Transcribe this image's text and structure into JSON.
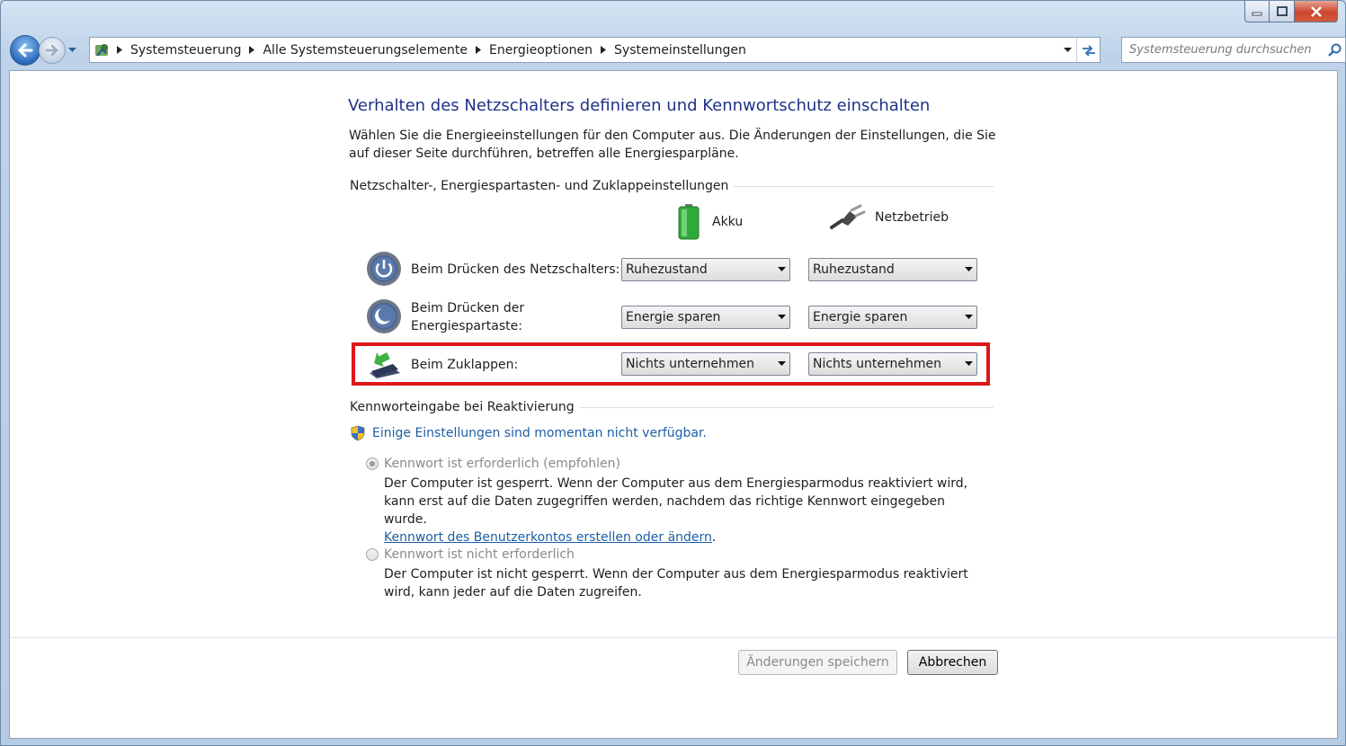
{
  "toolbar": {
    "breadcrumbs": [
      "Systemsteuerung",
      "Alle Systemsteuerungselemente",
      "Energieoptionen",
      "Systemeinstellungen"
    ],
    "search_placeholder": "Systemsteuerung durchsuchen"
  },
  "page": {
    "title": "Verhalten des Netzschalters definieren und Kennwortschutz einschalten",
    "intro": "Wählen Sie die Energieeinstellungen für den Computer aus. Die Änderungen der Einstellungen, die Sie auf dieser Seite durchführen, betreffen alle Energiesparpläne."
  },
  "buttons_section": {
    "heading": "Netzschalter-, Energiespartasten- und Zuklappeinstellungen",
    "col_battery": "Akku",
    "col_ac": "Netzbetrieb",
    "rows": [
      {
        "label": "Beim Drücken des Netzschalters:",
        "battery": "Ruhezustand",
        "ac": "Ruhezustand",
        "icon": "power-button-icon"
      },
      {
        "label_line1": "Beim Drücken der",
        "label_line2": "Energiespartaste:",
        "battery": "Energie sparen",
        "ac": "Energie sparen",
        "icon": "sleep-button-icon"
      },
      {
        "label": "Beim Zuklappen:",
        "battery": "Nichts unternehmen",
        "ac": "Nichts unternehmen",
        "icon": "lid-close-icon"
      }
    ]
  },
  "password_section": {
    "heading": "Kennworteingabe bei Reaktivierung",
    "uac_link": "Einige Einstellungen sind momentan nicht verfügbar.",
    "option_required": {
      "label": "Kennwort ist erforderlich (empfohlen)",
      "desc": "Der Computer ist gesperrt. Wenn der Computer aus dem Energiesparmodus reaktiviert wird, kann erst auf die Daten zugegriffen werden, nachdem das richtige Kennwort eingegeben wurde.",
      "link": "Kennwort des Benutzerkontos erstellen oder ändern",
      "selected": true
    },
    "option_not_required": {
      "label": "Kennwort ist nicht erforderlich",
      "desc": "Der Computer ist nicht gesperrt. Wenn der Computer aus dem Energiesparmodus reaktiviert wird, kann jeder auf die Daten zugreifen.",
      "selected": false
    }
  },
  "footer": {
    "save_label": "Änderungen speichern",
    "cancel_label": "Abbrechen"
  },
  "colors": {
    "title": "#1e3287",
    "link": "#1c5fa6",
    "highlight": "#e0161b"
  }
}
